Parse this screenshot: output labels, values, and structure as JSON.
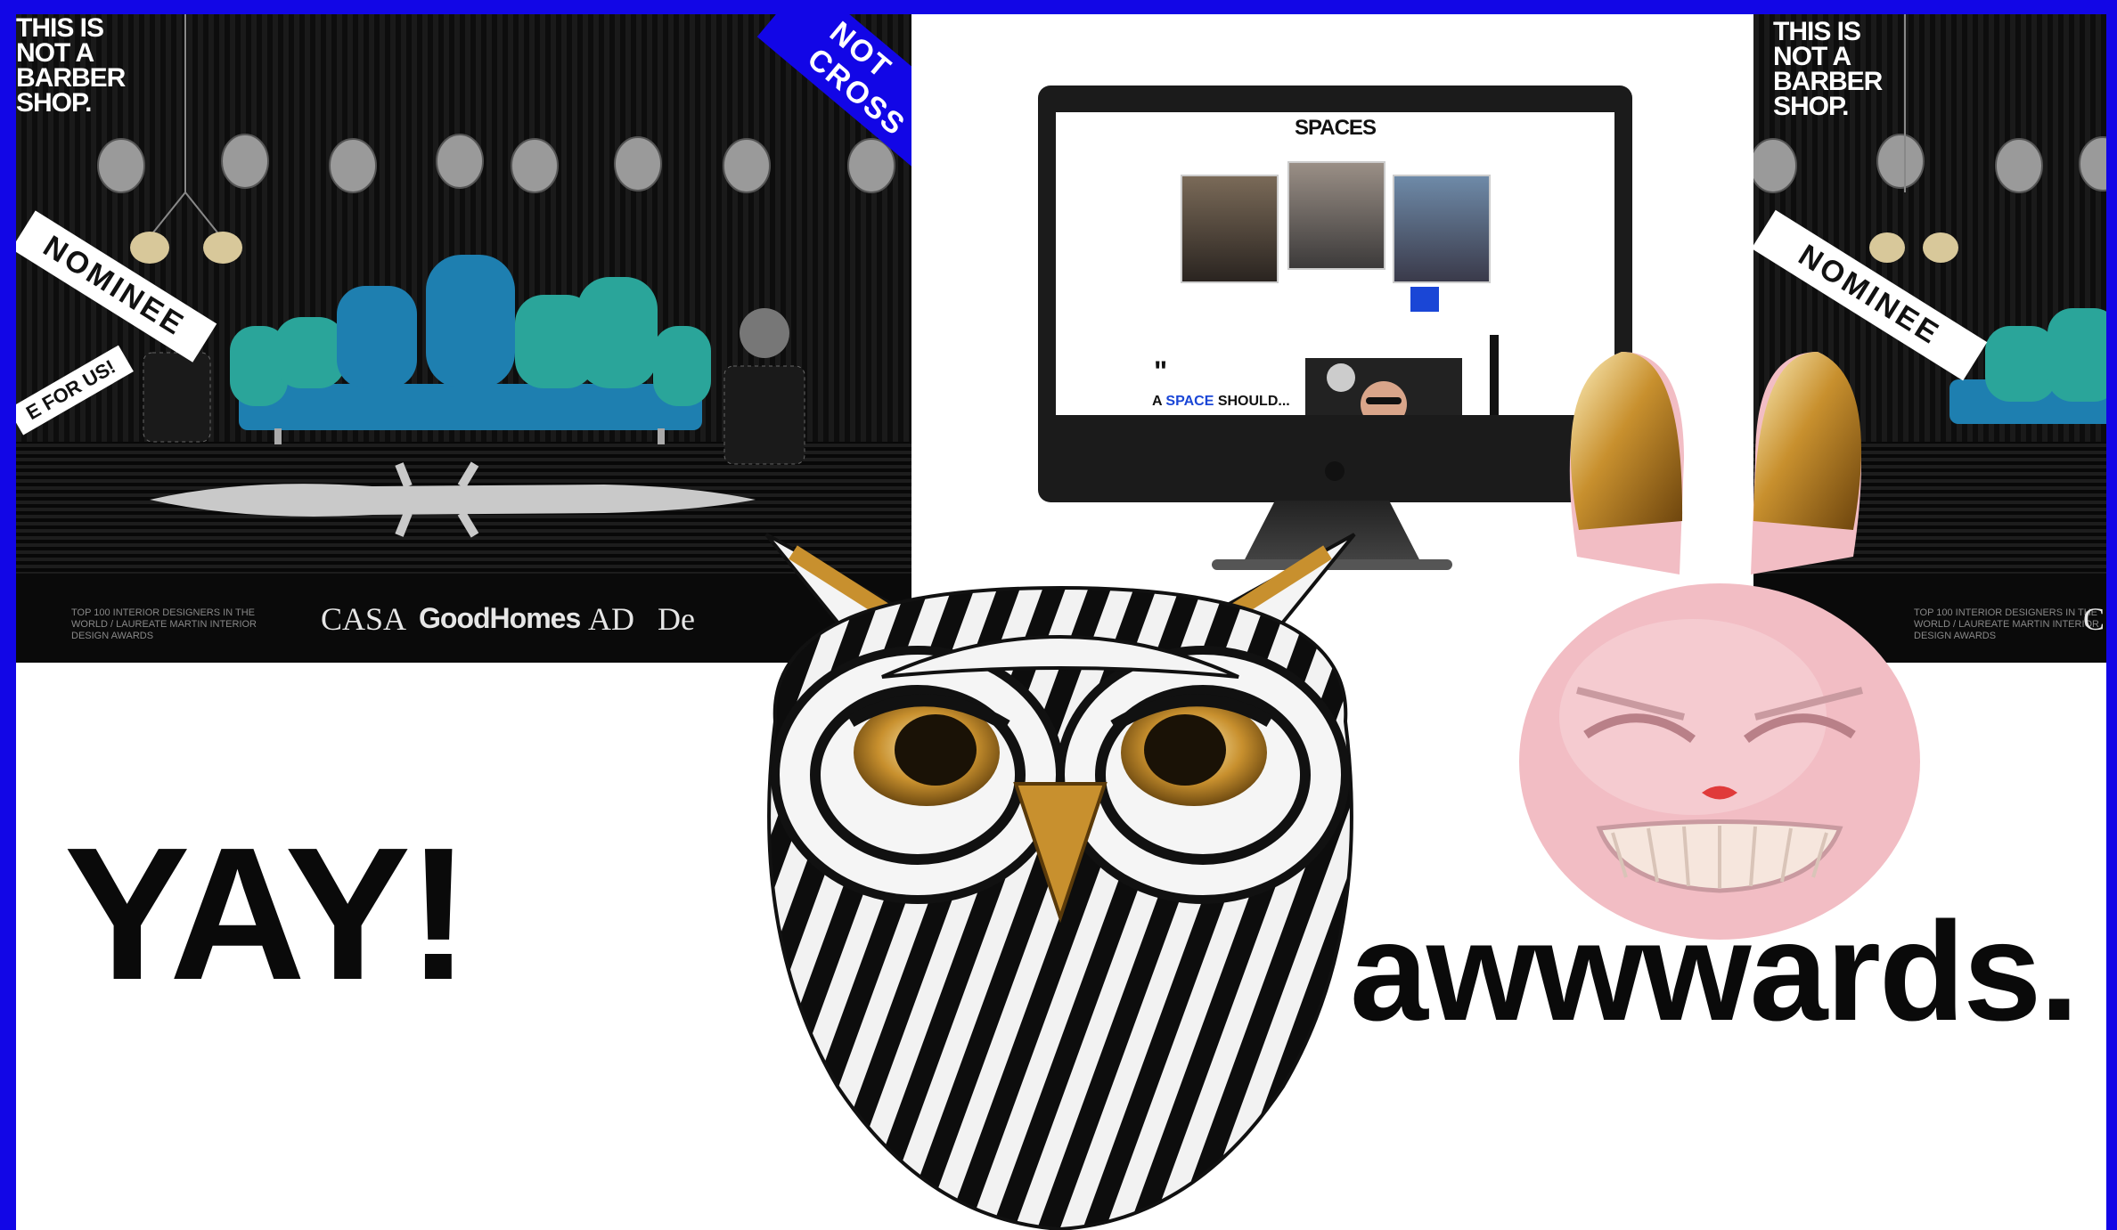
{
  "panels": {
    "left": {
      "shop_title": "THIS IS\nNOT A\nBARBER\nSHOP.",
      "badge": "NOMINEE",
      "vote_text": "E FOR US!",
      "corner_ribbon": "NOT CROSS",
      "footer_blurb": "TOP 100 INTERIOR DESIGNERS IN THE WORLD / LAUREATE MARTIN INTERIOR DESIGN AWARDS",
      "logos": [
        "CASA",
        "GoodHomes",
        "AD",
        "De"
      ]
    },
    "right": {
      "shop_title": "THIS IS\nNOT A\nBARBER\nSHOP.",
      "badge": "NOMINEE",
      "footer_blurb": "TOP 100 INTERIOR DESIGNERS IN THE WORLD / LAUREATE MARTIN INTERIOR DESIGN AWARDS",
      "logo": "C"
    }
  },
  "computer_mock": {
    "site_title": "SPACES",
    "site_heading_prefix": "A",
    "site_heading_highlight": "SPACE",
    "site_heading_suffix": "SHOULD..."
  },
  "wordmarks": {
    "yay": "YAY!",
    "awwwards": "awwwards."
  },
  "sculptures": [
    {
      "name": "owl-mask-icon"
    },
    {
      "name": "pink-rabbit-head-icon"
    }
  ],
  "colors": {
    "frame_blue": "#1206e6",
    "sofa_blue": "#1e7fb0",
    "gold": "#c8902e",
    "rabbit_pink": "#f2bdc4"
  }
}
